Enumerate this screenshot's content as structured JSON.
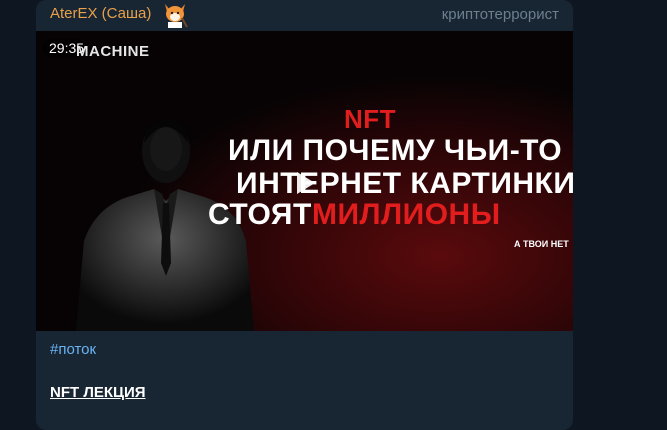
{
  "message": {
    "author": "AterEX (Саша)",
    "author_badge": "криптотеррорист",
    "video": {
      "duration": "29:35",
      "brand": "MACHINE",
      "title_line1": "NFT",
      "title_line2": "ИЛИ ПОЧЕМУ ЧЬИ-ТО",
      "title_line3": "ИНТЕРНЕТ КАРТИНКИ",
      "title_line4a": "СТОЯТ",
      "title_line4b": "МИЛЛИОНЫ",
      "title_note": "А ТВОИ НЕТ",
      "play_icon": "play-icon"
    },
    "hashtag": "#поток",
    "lecture_title": "NFT ЛЕКЦИЯ"
  },
  "colors": {
    "background": "#0e1621",
    "bubble": "#182533",
    "author": "#e8a14a",
    "badge": "#6d7f8f",
    "link": "#6ab3f3",
    "accent_red": "#e11d1d"
  }
}
